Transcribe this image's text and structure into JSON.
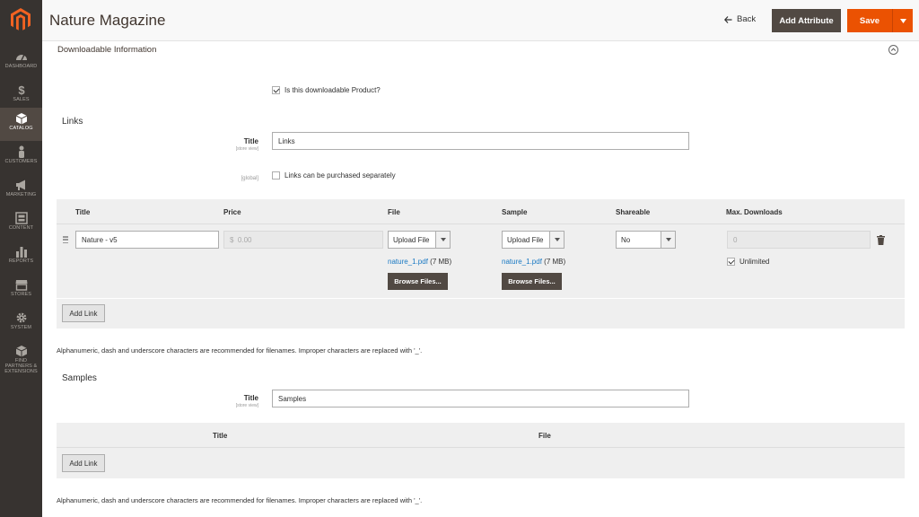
{
  "sidebar": {
    "items": [
      {
        "label": "DASHBOARD",
        "icon": "dashboard-icon"
      },
      {
        "label": "SALES",
        "icon": "dollar-icon"
      },
      {
        "label": "CATALOG",
        "icon": "cube-icon",
        "active": true
      },
      {
        "label": "CUSTOMERS",
        "icon": "person-icon"
      },
      {
        "label": "MARKETING",
        "icon": "megaphone-icon"
      },
      {
        "label": "CONTENT",
        "icon": "content-icon"
      },
      {
        "label": "REPORTS",
        "icon": "bar-chart-icon"
      },
      {
        "label": "STORES",
        "icon": "store-icon"
      },
      {
        "label": "SYSTEM",
        "icon": "gear-icon"
      },
      {
        "label": "FIND PARTNERS & EXTENSIONS",
        "icon": "partners-icon"
      }
    ]
  },
  "header": {
    "title": "Nature Magazine",
    "back_label": "Back",
    "add_attribute_label": "Add Attribute",
    "save_label": "Save"
  },
  "section": {
    "title": "Downloadable Information",
    "is_downloadable_label": "Is this downloadable Product?"
  },
  "links": {
    "heading": "Links",
    "title_label": "Title",
    "title_scope": "[store view]",
    "title_value": "Links",
    "separately_scope": "[global]",
    "separately_label": "Links can be purchased separately",
    "columns": [
      "Title",
      "Price",
      "File",
      "Sample",
      "Shareable",
      "Max. Downloads"
    ],
    "row": {
      "title": "Nature - v5",
      "price_symbol": "$",
      "price_placeholder": "0.00",
      "file_select": "Upload File",
      "file_name": "nature_1.pdf",
      "file_size": "(7 MB)",
      "sample_select": "Upload File",
      "sample_name": "nature_1.pdf",
      "sample_size": "(7 MB)",
      "shareable": "No",
      "max_downloads": "0",
      "unlimited_label": "Unlimited",
      "browse_label": "Browse Files..."
    },
    "add_link_label": "Add Link",
    "note": "Alphanumeric, dash and underscore characters are recommended for filenames. Improper characters are replaced with '_'."
  },
  "samples": {
    "heading": "Samples",
    "title_label": "Title",
    "title_scope": "[store view]",
    "title_value": "Samples",
    "columns": [
      "Title",
      "File"
    ],
    "add_link_label": "Add Link",
    "note": "Alphanumeric, dash and underscore characters are recommended for filenames. Improper characters are replaced with '_'."
  },
  "colors": {
    "accent": "#eb5202",
    "sidebar": "#373330",
    "dark_button": "#514943",
    "link": "#1979c3"
  }
}
